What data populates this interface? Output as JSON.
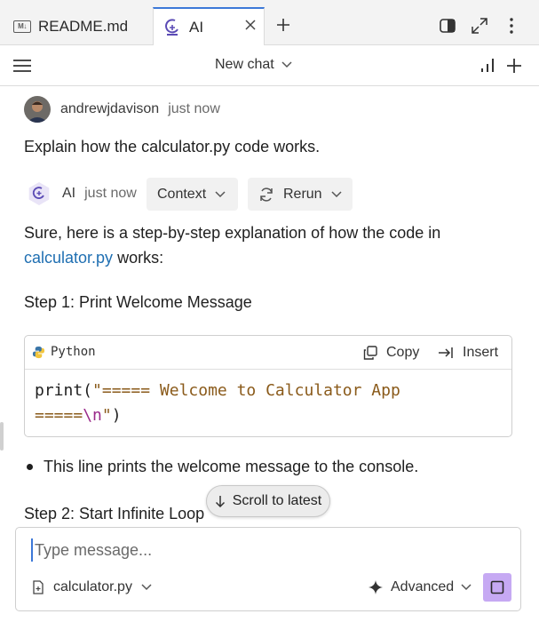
{
  "tabs": [
    {
      "label": "README.md",
      "icon": "markdown-icon",
      "badge": "M↓",
      "active": false
    },
    {
      "label": "AI",
      "icon": "ai-logo-icon",
      "active": true
    }
  ],
  "toolbar": {
    "title": "New chat"
  },
  "messages": {
    "user": {
      "author": "andrewjdavison",
      "time": "just now",
      "text": "Explain how the calculator.py code works."
    },
    "ai": {
      "author": "AI",
      "time": "just now",
      "context_label": "Context",
      "rerun_label": "Rerun",
      "intro_prefix": "Sure, here is a step-by-step explanation of how the code in",
      "intro_link": "calculator.py",
      "intro_suffix": "works:",
      "step1": "Step 1: Print Welcome Message",
      "code": {
        "language": "Python",
        "copy_label": "Copy",
        "insert_label": "Insert",
        "line1_fn": "print(",
        "line1_str": "\"===== Welcome to Calculator App",
        "line2_str": "=====",
        "line2_esc": "\\n",
        "line2_quote": "\"",
        "line2_close": ")"
      },
      "bullet1": "This line prints the welcome message to the console.",
      "step2": "Step 2: Start Infinite Loop"
    }
  },
  "scroll_latest": "Scroll to latest",
  "input": {
    "placeholder": "Type message...",
    "file": "calculator.py",
    "mode": "Advanced"
  },
  "colors": {
    "accent": "#3c78d8",
    "send_button": "#c6a9f3",
    "link": "#1f6fb2",
    "ai_badge": "#5b4bb5"
  }
}
